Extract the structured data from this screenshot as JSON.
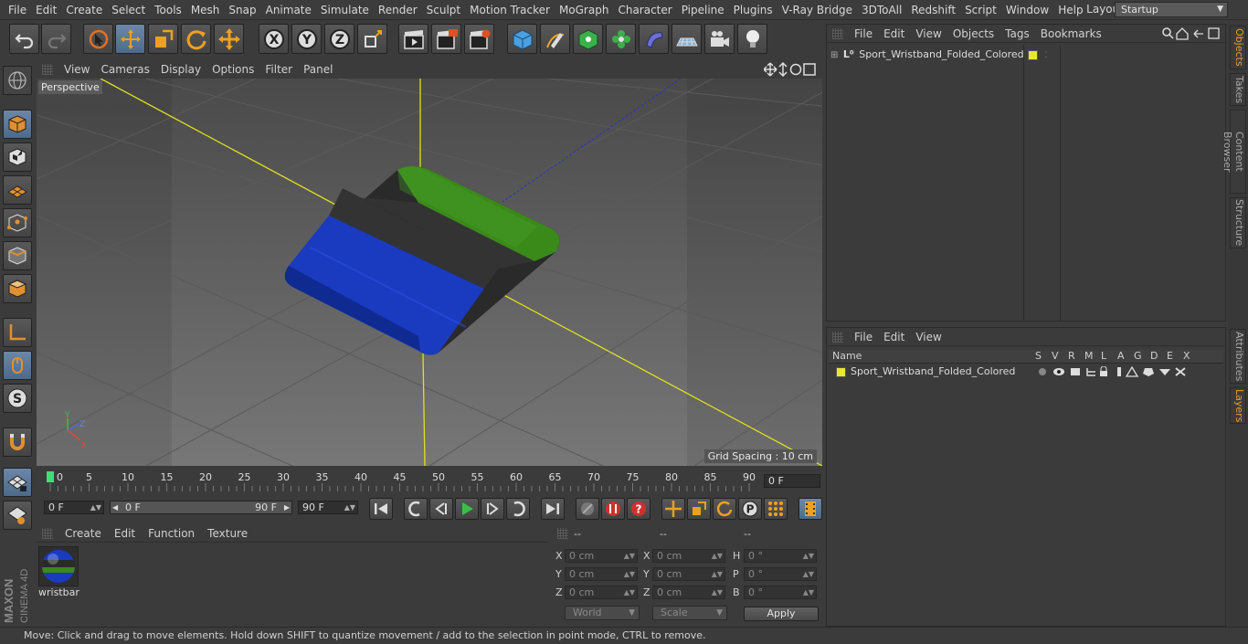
{
  "menu": [
    "File",
    "Edit",
    "Create",
    "Select",
    "Tools",
    "Mesh",
    "Snap",
    "Animate",
    "Simulate",
    "Render",
    "Sculpt",
    "Motion Tracker",
    "MoGraph",
    "Character",
    "Pipeline",
    "Plugins",
    "V-Ray Bridge",
    "3DToAll",
    "Redshift",
    "Script",
    "Window",
    "Help"
  ],
  "layout": {
    "label": "Layout:",
    "value": "Startup"
  },
  "viewport": {
    "menu": [
      "View",
      "Cameras",
      "Display",
      "Options",
      "Filter",
      "Panel"
    ],
    "title": "Perspective",
    "grid_spacing": "Grid Spacing : 10 cm",
    "axis_labels": {
      "x": "X",
      "y": "Y",
      "z": "Z"
    }
  },
  "timeline": {
    "ticks": [
      "0",
      "5",
      "10",
      "15",
      "20",
      "25",
      "30",
      "35",
      "40",
      "45",
      "50",
      "55",
      "60",
      "65",
      "70",
      "75",
      "80",
      "85",
      "90"
    ],
    "current_frame": "0 F"
  },
  "transport": {
    "start": "0 F",
    "range_start": "0 F",
    "range_end": "90 F",
    "end": "90 F"
  },
  "materials": {
    "menu": [
      "Create",
      "Edit",
      "Function",
      "Texture"
    ],
    "items": [
      {
        "name": "wristbar"
      }
    ]
  },
  "coords": {
    "headers": [
      "--",
      "--",
      "--"
    ],
    "rows": [
      {
        "label": "X",
        "pos": "0 cm",
        "label2": "X",
        "size": "0 cm",
        "label3": "H",
        "rot": "0 °"
      },
      {
        "label": "Y",
        "pos": "0 cm",
        "label2": "Y",
        "size": "0 cm",
        "label3": "P",
        "rot": "0 °"
      },
      {
        "label": "Z",
        "pos": "0 cm",
        "label2": "Z",
        "size": "0 cm",
        "label3": "B",
        "rot": "0 °"
      }
    ],
    "world": "World",
    "scale": "Scale",
    "apply": "Apply"
  },
  "objects": {
    "menu": [
      "File",
      "Edit",
      "View",
      "Objects",
      "Tags",
      "Bookmarks"
    ],
    "items": [
      {
        "name": "Sport_Wristband_Folded_Colored",
        "color": "#e8e830"
      }
    ]
  },
  "layers": {
    "menu": [
      "File",
      "Edit",
      "View"
    ],
    "header": {
      "name": "Name",
      "cols": [
        "S",
        "V",
        "R",
        "M",
        "L",
        "A",
        "G",
        "D",
        "E",
        "X"
      ]
    },
    "items": [
      {
        "name": "Sport_Wristband_Folded_Colored",
        "color": "#e8e830"
      }
    ]
  },
  "right_tabs": [
    "Objects",
    "Takes",
    "Content Browser",
    "Structure",
    "Attributes",
    "Layers"
  ],
  "status": "Move: Click and drag to move elements. Hold down SHIFT to quantize movement / add to the selection in point mode, CTRL to remove.",
  "brand": {
    "line1": "MAXON",
    "line2": "CINEMA 4D"
  },
  "colors": {
    "accent": "#6b88a8",
    "tab_active": "#e8a030",
    "layer_yellow": "#e8e830"
  }
}
